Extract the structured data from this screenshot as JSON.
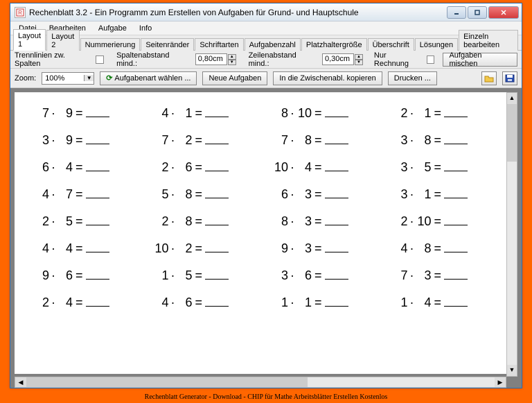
{
  "window": {
    "title": "Rechenblatt 3.2 - Ein Programm zum Erstellen von Aufgaben für Grund- und Hauptschule"
  },
  "menu": {
    "items": [
      "Datei",
      "Bearbeiten",
      "Aufgabe",
      "Info"
    ]
  },
  "tabs": {
    "items": [
      "Layout 1",
      "Layout 2",
      "Nummerierung",
      "Seitenränder",
      "Schriftarten",
      "Aufgabenzahl",
      "Platzhaltergröße",
      "Überschrift",
      "Lösungen",
      "Einzeln bearbeiten"
    ],
    "active_index": 0
  },
  "layout_options": {
    "sep_lines_label": "Trennlinien zw. Spalten",
    "col_spacing_label": "Spaltenabstand mind.:",
    "col_spacing_value": "0,80cm",
    "row_spacing_label": "Zeilenabstand mind.:",
    "row_spacing_value": "0,30cm",
    "only_calc_label": "Nur Rechnung",
    "shuffle_button": "Aufgaben mischen"
  },
  "toolbar": {
    "zoom_label": "Zoom:",
    "zoom_value": "100%",
    "choose_type": "Aufgabenart wählen ...",
    "new_problems": "Neue Aufgaben",
    "copy_clipboard": "In die Zwischenabl. kopieren",
    "print": "Drucken ..."
  },
  "worksheet": {
    "operator": "·",
    "equals": "=",
    "problems": [
      {
        "a": 7,
        "b": 9
      },
      {
        "a": 4,
        "b": 1
      },
      {
        "a": 8,
        "b": 10
      },
      {
        "a": 2,
        "b": 1
      },
      {
        "a": 3,
        "b": 9
      },
      {
        "a": 7,
        "b": 2
      },
      {
        "a": 7,
        "b": 8
      },
      {
        "a": 3,
        "b": 8
      },
      {
        "a": 6,
        "b": 4
      },
      {
        "a": 2,
        "b": 6
      },
      {
        "a": 10,
        "b": 4
      },
      {
        "a": 3,
        "b": 5
      },
      {
        "a": 4,
        "b": 7
      },
      {
        "a": 5,
        "b": 8
      },
      {
        "a": 6,
        "b": 3
      },
      {
        "a": 3,
        "b": 1
      },
      {
        "a": 2,
        "b": 5
      },
      {
        "a": 2,
        "b": 8
      },
      {
        "a": 8,
        "b": 3
      },
      {
        "a": 2,
        "b": 10
      },
      {
        "a": 4,
        "b": 4
      },
      {
        "a": 10,
        "b": 2
      },
      {
        "a": 9,
        "b": 3
      },
      {
        "a": 4,
        "b": 8
      },
      {
        "a": 9,
        "b": 6
      },
      {
        "a": 1,
        "b": 5
      },
      {
        "a": 3,
        "b": 6
      },
      {
        "a": 7,
        "b": 3
      },
      {
        "a": 2,
        "b": 4
      },
      {
        "a": 4,
        "b": 6
      },
      {
        "a": 1,
        "b": 1
      },
      {
        "a": 1,
        "b": 4
      }
    ]
  },
  "caption": "Rechenblatt Generator - Download - CHIP für Mathe Arbeitsblätter Erstellen Kostenlos"
}
